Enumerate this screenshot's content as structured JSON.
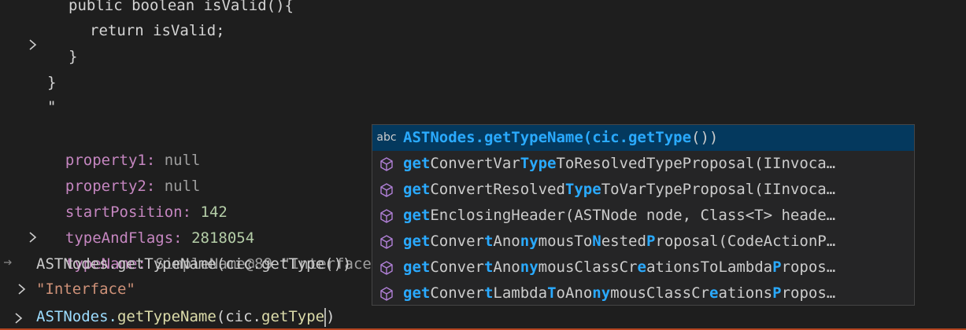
{
  "code": {
    "line1": "public boolean isValid(){",
    "line2": "return isValid;",
    "line3": "}",
    "line4": "}",
    "line5": "\""
  },
  "properties": [
    {
      "name": "property1:",
      "value": "null"
    },
    {
      "name": "property2:",
      "value": "null"
    },
    {
      "name": "startPosition:",
      "value": "142"
    },
    {
      "name": "typeAndFlags:",
      "value": "2818054"
    },
    {
      "name": "typeName:",
      "value": "SimpleName@89 \"Interface\""
    }
  ],
  "repl": {
    "input_echo": "ASTNodes.getTypeName(cic.getType())",
    "result": "\"Interface\"",
    "prompt_prefix": "ASTNodes.",
    "prompt_fn": "getTypeName",
    "prompt_mid": "(cic.",
    "prompt_fn2": "getType",
    "prompt_end": ")"
  },
  "suggestions": [
    {
      "icon": "abc",
      "segments": [
        [
          "ASTNodes.getTypeName(cic.getType",
          true
        ],
        [
          "())",
          false
        ]
      ]
    },
    {
      "icon": "method",
      "segments": [
        [
          "get",
          true
        ],
        [
          "ConvertVar",
          false
        ],
        [
          "Type",
          true
        ],
        [
          "ToResolvedTypeProposal(IInvoca…",
          false
        ]
      ]
    },
    {
      "icon": "method",
      "segments": [
        [
          "get",
          true
        ],
        [
          "ConvertResolved",
          false
        ],
        [
          "Type",
          true
        ],
        [
          "ToVarTypeProposal(IInvoca…",
          false
        ]
      ]
    },
    {
      "icon": "method",
      "segments": [
        [
          "get",
          true
        ],
        [
          "EnclosingHeader(ASTNode node, Class<T> heade…",
          false
        ]
      ]
    },
    {
      "icon": "method",
      "segments": [
        [
          "get",
          true
        ],
        [
          "Conver",
          false
        ],
        [
          "t",
          true
        ],
        [
          "Ano",
          false
        ],
        [
          "ny",
          true
        ],
        [
          "mousTo",
          false
        ],
        [
          "N",
          true
        ],
        [
          "ested",
          false
        ],
        [
          "P",
          true
        ],
        [
          "roposal(CodeActionP…",
          false
        ]
      ]
    },
    {
      "icon": "method",
      "segments": [
        [
          "get",
          true
        ],
        [
          "Conver",
          false
        ],
        [
          "t",
          true
        ],
        [
          "Ano",
          false
        ],
        [
          "ny",
          true
        ],
        [
          "mousClassCr",
          false
        ],
        [
          "e",
          true
        ],
        [
          "ationsToLambda",
          false
        ],
        [
          "P",
          true
        ],
        [
          "ropos…",
          false
        ]
      ]
    },
    {
      "icon": "method",
      "segments": [
        [
          "get",
          true
        ],
        [
          "Conver",
          false
        ],
        [
          "t",
          true
        ],
        [
          "Lambda",
          false
        ],
        [
          "T",
          true
        ],
        [
          "oAno",
          false
        ],
        [
          "ny",
          true
        ],
        [
          "mousClassCr",
          false
        ],
        [
          "e",
          true
        ],
        [
          "ations",
          false
        ],
        [
          "P",
          true
        ],
        [
          "ropos…",
          false
        ]
      ]
    }
  ],
  "colors": {
    "background": "#1e1e1e",
    "suggest_bg": "#252526",
    "selected_bg": "#04395e",
    "match_highlight": "#2aaaff",
    "property": "#c586c0",
    "number": "#b5cea8",
    "string": "#ce9178",
    "method_icon": "#b180d7",
    "input_border": "#b44420"
  }
}
